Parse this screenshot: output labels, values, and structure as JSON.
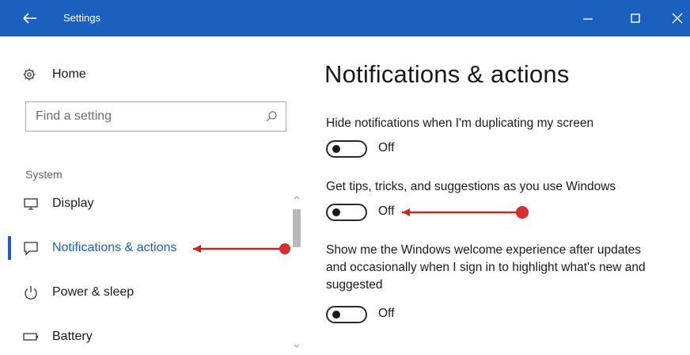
{
  "window": {
    "title": "Settings",
    "titlebar_color": "#1b5fbf",
    "icons": {
      "back": "arrow-left-icon",
      "minimize": "minimize-icon",
      "maximize": "maximize-icon",
      "close": "close-icon"
    }
  },
  "sidebar": {
    "home_label": "Home",
    "home_icon": "gear-icon",
    "search": {
      "placeholder": "Find a setting",
      "icon": "search-icon"
    },
    "section_header": "System",
    "items": [
      {
        "label": "Display",
        "icon": "monitor-icon",
        "selected": false
      },
      {
        "label": "Notifications & actions",
        "icon": "notification-icon",
        "selected": true
      },
      {
        "label": "Power & sleep",
        "icon": "power-icon",
        "selected": false
      },
      {
        "label": "Battery",
        "icon": "battery-icon",
        "selected": false
      }
    ]
  },
  "main": {
    "title": "Notifications & actions",
    "settings": [
      {
        "label": "Hide notifications when I'm duplicating my screen",
        "state": "Off"
      },
      {
        "label": "Get tips, tricks, and suggestions as you use Windows",
        "state": "Off"
      },
      {
        "label": "Show me the Windows welcome experience after updates and occasionally when I sign in to highlight what's new and suggested",
        "state": "Off"
      }
    ]
  },
  "annotation_color": "#c62828"
}
